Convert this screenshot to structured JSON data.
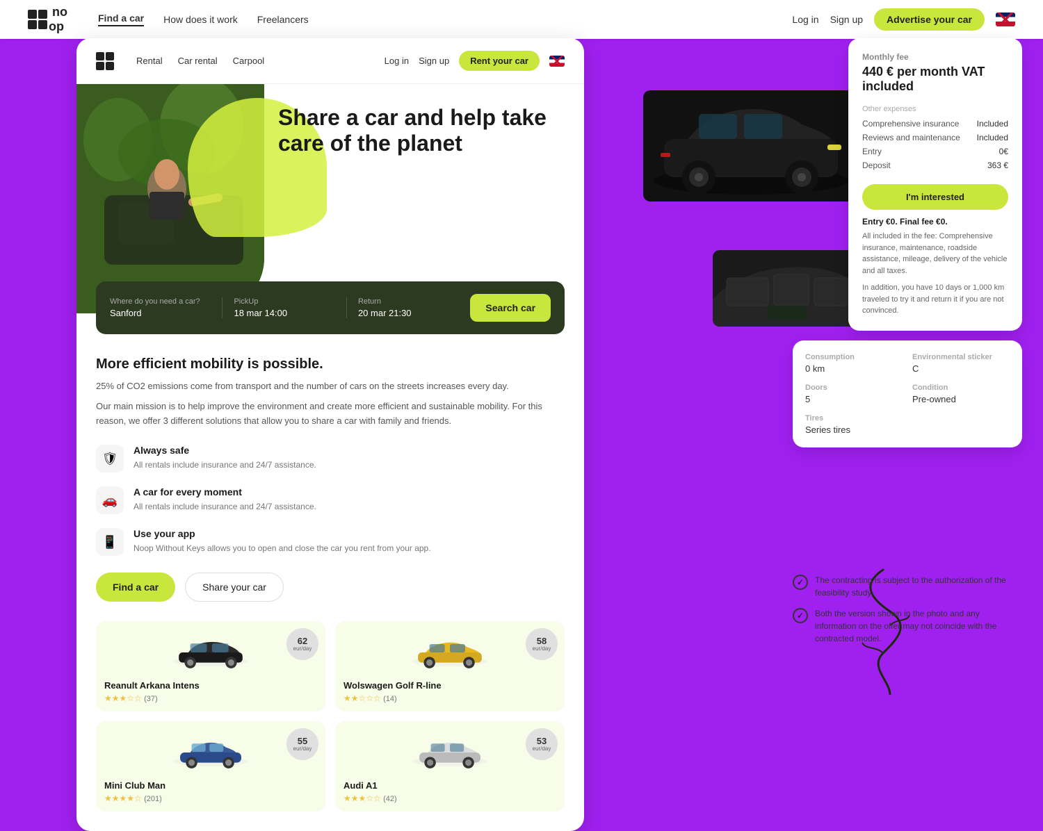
{
  "topnav": {
    "logo": "noop",
    "links": [
      {
        "label": "Find a car",
        "active": true
      },
      {
        "label": "How does it work",
        "active": false
      },
      {
        "label": "Freelancers",
        "active": false
      }
    ],
    "right": {
      "login": "Log in",
      "signup": "Sign up",
      "advertise": "Advertise your car"
    }
  },
  "cardnav": {
    "links": [
      "Rental",
      "Car rental",
      "Carpool"
    ],
    "login": "Log in",
    "signup": "Sign up",
    "rent_btn": "Rent your car"
  },
  "hero": {
    "title": "Share a car and help take care of the planet",
    "search": {
      "location_label": "Where do you need a car?",
      "location_value": "Sanford",
      "pickup_label": "PickUp",
      "pickup_value": "18 mar 14:00",
      "return_label": "Return",
      "return_value": "20 mar 21:30",
      "button": "Search car"
    }
  },
  "mobility": {
    "title": "More efficient mobility is possible.",
    "para1": "25% of CO2 emissions come from transport and the number of cars on the streets increases every day.",
    "para2": "Our main mission is to help improve the environment and create more efficient and sustainable mobility. For this reason, we offer 3 different solutions that allow you to share a car with family and friends."
  },
  "features": [
    {
      "icon": "🛡",
      "title": "Always safe",
      "desc": "All rentals include insurance and 24/7 assistance."
    },
    {
      "icon": "🚗",
      "title": "A car for every moment",
      "desc": "All rentals include insurance and 24/7 assistance."
    },
    {
      "icon": "📱",
      "title": "Use your app",
      "desc": "Noop Without Keys allows you to open and close the car you rent from your app."
    }
  ],
  "bottom_btns": {
    "find": "Find a car",
    "share": "Share your car"
  },
  "cars": [
    {
      "name": "Reanult Arkana Intens",
      "price": "62",
      "per": "eur/day",
      "stars": 3.5,
      "reviews": 37,
      "color": "dark"
    },
    {
      "name": "Wolswagen Golf R-line",
      "price": "58",
      "per": "eur/day",
      "stars": 2.5,
      "reviews": 14,
      "color": "yellow"
    },
    {
      "name": "Mini Club Man",
      "price": "55",
      "per": "eur/day",
      "stars": 4,
      "reviews": 201,
      "color": "blue"
    },
    {
      "name": "Audi A1",
      "price": "53",
      "per": "eur/day",
      "stars": 3,
      "reviews": 42,
      "color": "white"
    }
  ],
  "rightpanel": {
    "monthly_label": "Monthly fee",
    "monthly_price": "440 € per month VAT included",
    "other_label": "Other expenses",
    "expenses": [
      {
        "label": "Comprehensive insurance",
        "value": "Included"
      },
      {
        "label": "Reviews and maintenance",
        "value": "Included"
      },
      {
        "label": "Entry",
        "value": "0€"
      },
      {
        "label": "Deposit",
        "value": "363 €"
      }
    ],
    "cta": "I'm interested",
    "entry_title": "Entry €0. Final fee €0.",
    "entry_desc": "All included in the fee: Comprehensive insurance, maintenance, roadside assistance, mileage, delivery of the vehicle and all taxes.",
    "try_desc": "In addition, you have 10 days or 1,000 km traveled to try it and return it if you are not convinced."
  },
  "specs": {
    "consumption_label": "Consumption",
    "consumption_value": "0 km",
    "env_label": "Environmental sticker",
    "env_value": "C",
    "doors_label": "Doors",
    "doors_value": "5",
    "condition_label": "Condition",
    "condition_value": "Pre-owned",
    "tires_label": "Tires",
    "tires_value": "Series tires"
  },
  "checks": [
    "The contracting is subject to the authorization of the feasibility study.",
    "Both the version shown in the photo and any information on the offer may not coincide with the contracted model."
  ]
}
